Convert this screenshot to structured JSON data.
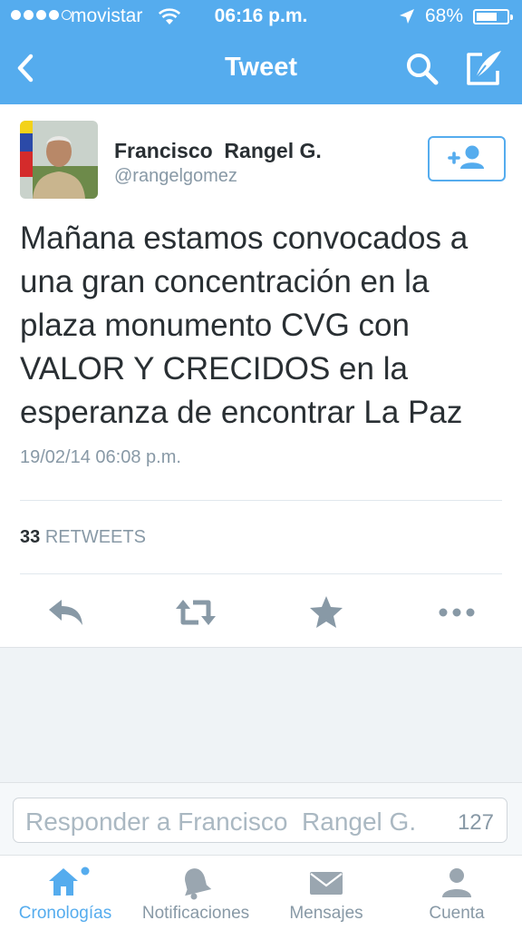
{
  "status_bar": {
    "carrier": "movistar",
    "time": "06:16 p.m.",
    "battery": "68%",
    "battery_level": 0.68
  },
  "nav": {
    "title": "Tweet",
    "back_icon": "chevron-left-icon",
    "search_icon": "search-icon",
    "compose_icon": "compose-icon"
  },
  "tweet": {
    "author_name": "Francisco  Rangel G.",
    "author_handle": "@rangelgomez",
    "follow_icon": "add-user-icon",
    "text": "Mañana estamos convocados a una gran concentración en la plaza monumento CVG con VALOR Y CRECIDOS en la esperanza de encontrar La Paz",
    "timestamp": "19/02/14 06:08 p.m.",
    "retweet_count": "33",
    "retweet_label": "RETWEETS"
  },
  "actions": [
    "reply-icon",
    "retweet-icon",
    "favorite-icon",
    "more-icon"
  ],
  "reply": {
    "placeholder": "Responder a Francisco  Rangel G.",
    "char_count": "127"
  },
  "tabs": [
    {
      "label": "Cronologías",
      "icon": "home-icon",
      "active": true
    },
    {
      "label": "Notificaciones",
      "icon": "bell-icon",
      "active": false
    },
    {
      "label": "Mensajes",
      "icon": "envelope-icon",
      "active": false
    },
    {
      "label": "Cuenta",
      "icon": "person-icon",
      "active": false
    }
  ],
  "colors": {
    "brand": "#55acee",
    "text": "#292f33",
    "muted": "#8899a6",
    "icon_gray": "#9aa6b0"
  }
}
